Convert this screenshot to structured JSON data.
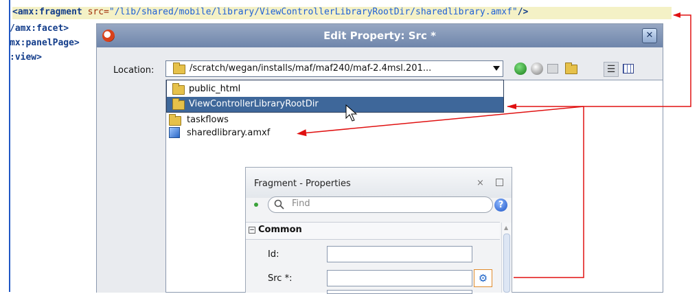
{
  "editor": {
    "line1": {
      "tag": "<amx:fragment",
      "attr": "src=",
      "value": "\"/lib/shared/mobile/library/ViewControllerLibraryRootDir/sharedlibrary.amxf\"",
      "close": "/>"
    },
    "line2": "/amx:facet>",
    "line3": "mx:panelPage>",
    "line4": ":view>"
  },
  "dialog": {
    "title": "Edit Property: Src *",
    "close_icon": "close-icon",
    "location_label": "Location:",
    "location_value": "/scratch/wegan/installs/maf/maf240/maf-2.4msl.201...",
    "toolbar_icons": [
      "back-icon",
      "forward-icon",
      "folder-up-icon",
      "new-folder-icon",
      "list-view-icon",
      "details-view-icon"
    ],
    "dropdown_items": [
      "public_html",
      "ViewControllerLibraryRootDir"
    ],
    "list_items": [
      "taskflows",
      "sharedlibrary.amxf"
    ]
  },
  "properties": {
    "title": "Fragment - Properties",
    "find_placeholder": "Find",
    "section": "Common",
    "fields": [
      {
        "label": "Id:",
        "value": ""
      },
      {
        "label": "Src *:",
        "value": ""
      }
    ]
  },
  "colors": {
    "arrow": "#e01010",
    "selection": "#3e679a",
    "title_bar": "#7f93b5"
  }
}
